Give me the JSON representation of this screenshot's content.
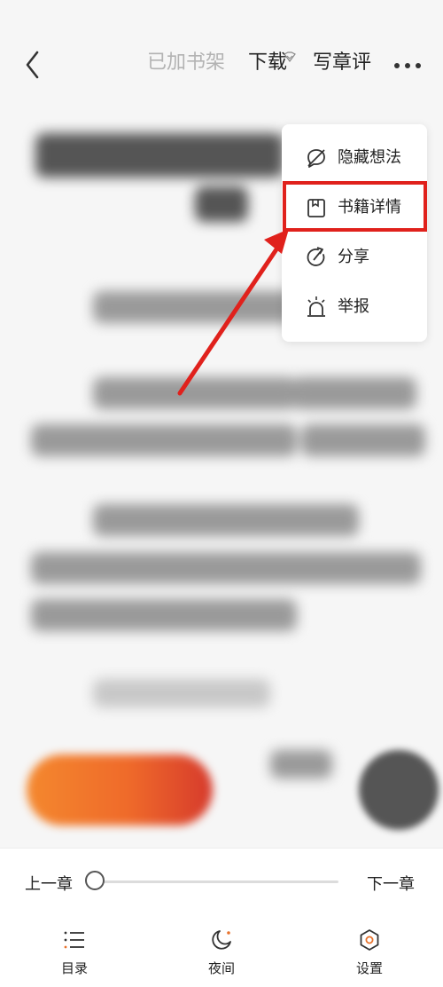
{
  "nav": {
    "added_to_shelf": "已加书架",
    "download": "下载",
    "write_review": "写章评"
  },
  "menu": {
    "items": [
      {
        "label": "隐藏想法",
        "icon": "hide-thoughts-icon"
      },
      {
        "label": "书籍详情",
        "icon": "book-details-icon"
      },
      {
        "label": "分享",
        "icon": "share-icon"
      },
      {
        "label": "举报",
        "icon": "report-icon"
      }
    ],
    "highlighted_index": 1
  },
  "bottom": {
    "prev_chapter": "上一章",
    "next_chapter": "下一章",
    "progress": 0,
    "tabs": [
      {
        "label": "目录",
        "icon": "toc-icon"
      },
      {
        "label": "夜间",
        "icon": "night-mode-icon"
      },
      {
        "label": "设置",
        "icon": "settings-icon"
      }
    ]
  },
  "colors": {
    "annotation_red": "#e0211c",
    "accent_orange": "#ef6a2a"
  }
}
